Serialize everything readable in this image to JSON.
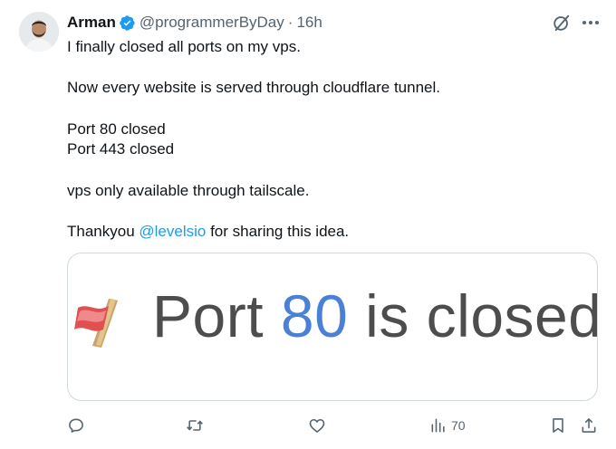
{
  "author": {
    "name": "Arman",
    "handle": "@programmerByDay",
    "separator": "·",
    "time": "16h",
    "verified": true
  },
  "tweet": {
    "lines": {
      "l1": "I finally closed all ports on my vps.",
      "l2": "Now every website is served through cloudflare tunnel.",
      "l3": "Port 80 closed",
      "l4": "Port 443 closed",
      "l5": "vps only available through tailscale.",
      "l6_pre": "Thankyou ",
      "l6_mention": "@levelsio",
      "l6_post": " for sharing this idea."
    }
  },
  "media": {
    "word1": "Port",
    "number": "80",
    "word2": "is closed",
    "flag_icon": "red-flag-icon"
  },
  "actions": {
    "reply_icon": "reply-icon",
    "retweet_icon": "retweet-icon",
    "like_icon": "like-icon",
    "views_icon": "views-icon",
    "views_count": "70",
    "bookmark_icon": "bookmark-icon",
    "share_icon": "share-icon"
  },
  "colors": {
    "text": "#0f1419",
    "muted": "#536471",
    "link": "#1d9bf0",
    "verified": "#1d9bf0",
    "border": "#cfd9de",
    "media_number": "#4a80d6",
    "media_text": "#4d4d4d"
  }
}
